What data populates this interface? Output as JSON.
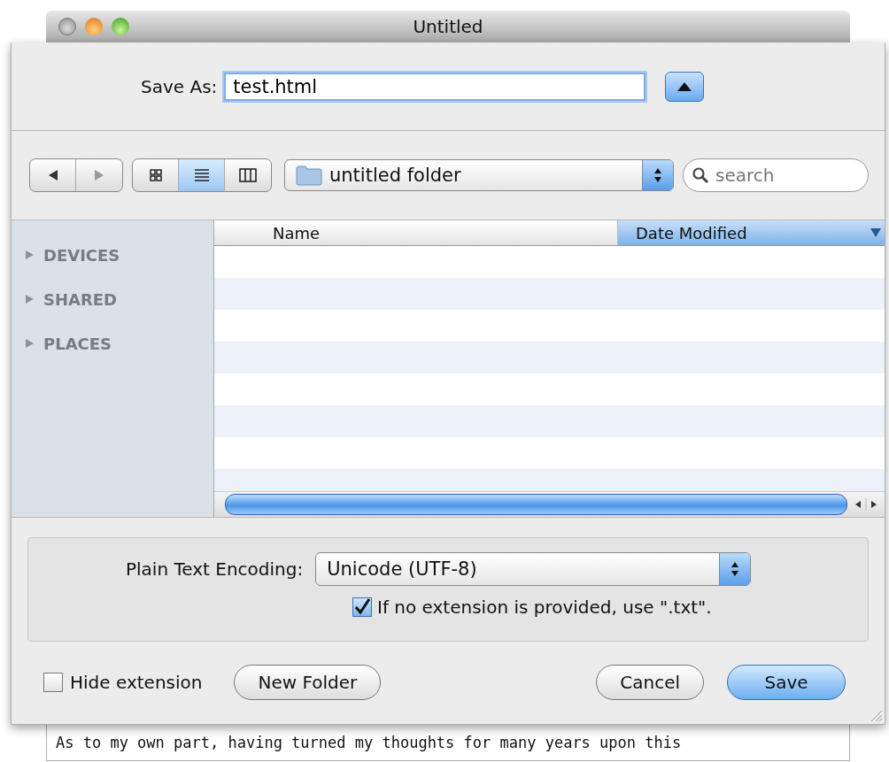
{
  "window": {
    "title": "Untitled"
  },
  "save_as": {
    "label": "Save As:",
    "value": "test.html"
  },
  "toolbar": {
    "view_modes": [
      {
        "kind": "icons",
        "selected": false
      },
      {
        "kind": "list",
        "selected": true
      },
      {
        "kind": "columns",
        "selected": false
      }
    ],
    "location": "untitled folder",
    "search": {
      "placeholder": "search"
    }
  },
  "sidebar": {
    "sections": [
      {
        "label": "DEVICES",
        "expanded": false
      },
      {
        "label": "SHARED",
        "expanded": false
      },
      {
        "label": "PLACES",
        "expanded": false
      }
    ]
  },
  "file_list": {
    "columns": [
      {
        "label": "Name",
        "selected": false
      },
      {
        "label": "Date Modified",
        "selected": true
      }
    ]
  },
  "options": {
    "encoding_label": "Plain Text Encoding:",
    "encoding": "Unicode (UTF-8)",
    "extension_checkbox": {
      "label": "If no extension is provided, use \".txt\".",
      "checked": true
    }
  },
  "hide_extension": {
    "label": "Hide extension",
    "checked": false
  },
  "buttons": [
    {
      "label": "New Folder",
      "kind": "plain"
    },
    {
      "label": "Cancel",
      "kind": "plain"
    },
    {
      "label": "Save",
      "kind": "default"
    }
  ],
  "document": {
    "visible_line": "As to my own part, having turned my thoughts for many years upon this"
  }
}
